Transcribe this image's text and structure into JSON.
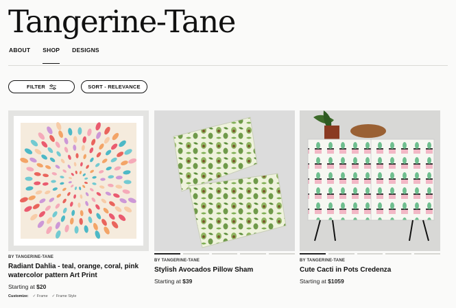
{
  "brand": {
    "name": "Tangerine-Tane"
  },
  "nav": [
    {
      "label": "ABOUT"
    },
    {
      "label": "SHOP"
    },
    {
      "label": "DESIGNS"
    }
  ],
  "controls": {
    "filter_label": "FILTER",
    "sort_label": "SORT - RELEVANCE"
  },
  "products": [
    {
      "artist": "BY TANGERINE-TANE",
      "title": "Radiant Dahlia - teal, orange, coral, pink watercolor pattern Art Print",
      "price_prefix": "Starting at",
      "price": "$20",
      "customize_label": "Customize:",
      "options": [
        "Frame",
        "Frame Style"
      ]
    },
    {
      "artist": "BY TANGERINE-TANE",
      "title": "Stylish Avocados Pillow Sham",
      "price_prefix": "Starting at",
      "price": "$39"
    },
    {
      "artist": "BY TANGERINE-TANE",
      "title": "Cute Cacti in Pots Credenza",
      "price_prefix": "Starting at",
      "price": "$1059"
    }
  ],
  "colors": {
    "background": "#fafaf9",
    "text": "#111111",
    "divider": "#d9d9d6"
  }
}
